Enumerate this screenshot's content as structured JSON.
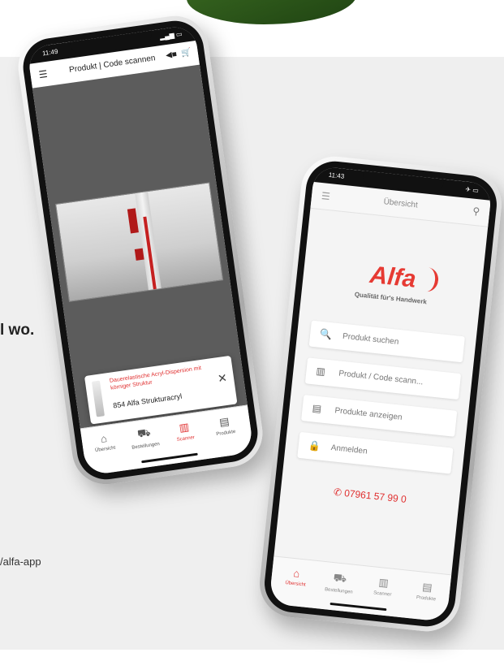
{
  "side_text": "l wo.",
  "side_link": "/alfa-app",
  "phone1": {
    "time": "11:49",
    "title": "Produkt | Code scannen",
    "popup": {
      "name": "Dauerelastische Acryl-Dispersion mit körniger Struktur",
      "product": "854 Alfa Strukturacryl",
      "close": "✕"
    },
    "tabs": [
      {
        "icon": "⌂",
        "label": "Übersicht"
      },
      {
        "icon": "⛟",
        "label": "Bestellungen"
      },
      {
        "icon": "▥",
        "label": "Scanner"
      },
      {
        "icon": "▤",
        "label": "Produkte"
      }
    ]
  },
  "phone2": {
    "time": "11:43",
    "title": "Übersicht",
    "logo": "Alfa",
    "tagline": "Qualität für's Handwerk",
    "items": [
      {
        "icon": "🔍",
        "label": "Produkt suchen"
      },
      {
        "icon": "▥",
        "label": "Produkt / Code scann..."
      },
      {
        "icon": "▤",
        "label": "Produkte anzeigen"
      },
      {
        "icon": "🔒",
        "label": "Anmelden"
      }
    ],
    "phone": "07961 57 99 0",
    "tabs": [
      {
        "icon": "⌂",
        "label": "Übersicht"
      },
      {
        "icon": "⛟",
        "label": "Bestellungen"
      },
      {
        "icon": "▥",
        "label": "Scanner"
      },
      {
        "icon": "▤",
        "label": "Produkte"
      }
    ]
  }
}
